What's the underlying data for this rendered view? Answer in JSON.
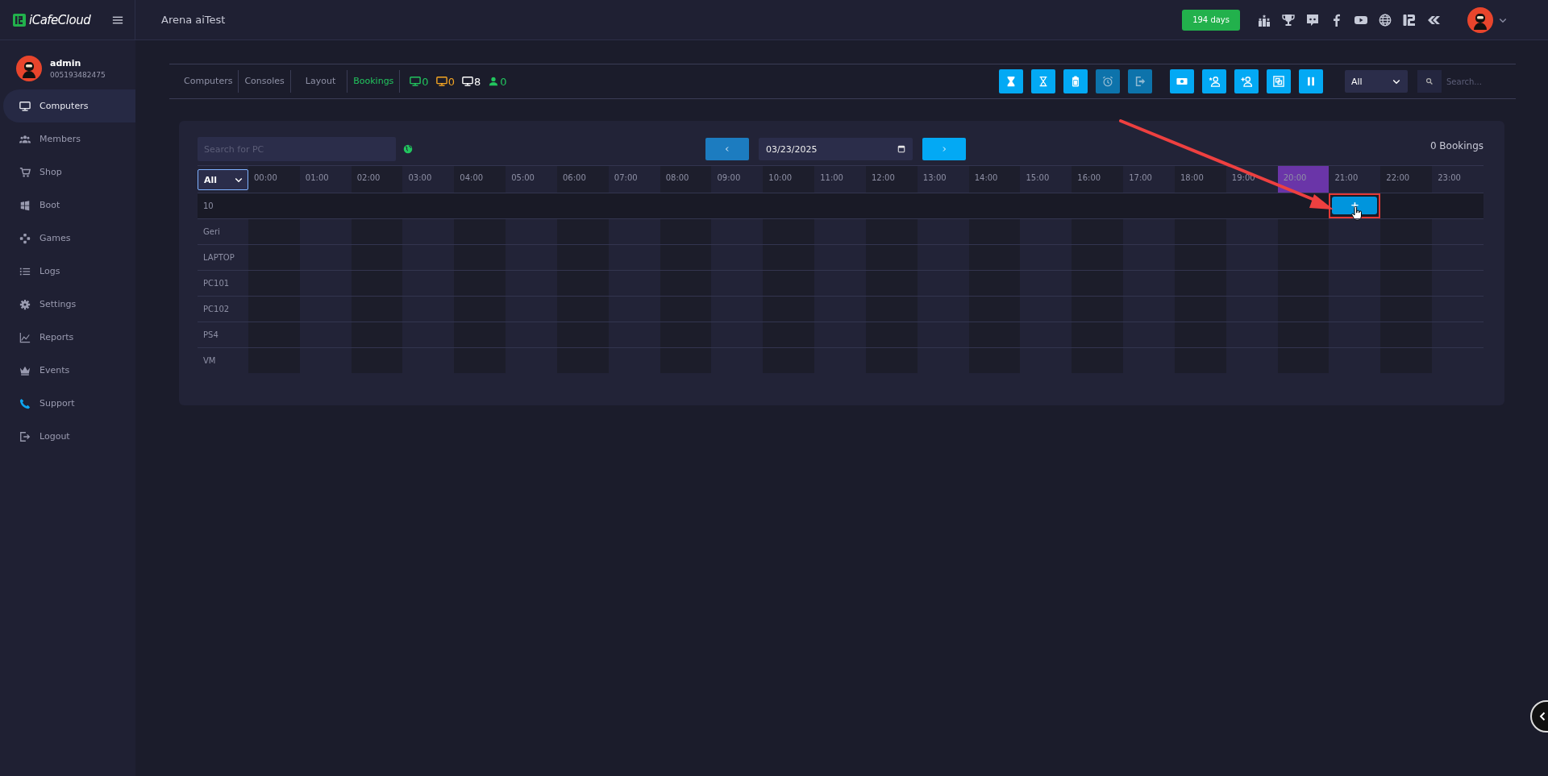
{
  "brand": {
    "name": "iCafeCloud"
  },
  "header": {
    "title": "Arena aiTest",
    "license_badge": "194 days",
    "links": [
      {
        "kind": "ranking"
      },
      {
        "kind": "trophy"
      },
      {
        "kind": "chat"
      },
      {
        "kind": "facebook"
      },
      {
        "kind": "video"
      },
      {
        "kind": "globe"
      },
      {
        "kind": "logo"
      },
      {
        "kind": "chevrons"
      }
    ]
  },
  "user": {
    "name": "admin",
    "id": "005193482475"
  },
  "sidebar": {
    "items": [
      {
        "label": "Computers",
        "kind": "monitor",
        "selected": true
      },
      {
        "label": "Members",
        "kind": "people",
        "selected": false
      },
      {
        "label": "Shop",
        "kind": "cart",
        "selected": false
      },
      {
        "label": "Boot",
        "kind": "windows",
        "selected": false
      },
      {
        "label": "Games",
        "kind": "gamepad",
        "selected": false
      },
      {
        "label": "Logs",
        "kind": "list",
        "selected": false
      },
      {
        "label": "Settings",
        "kind": "gear",
        "selected": false
      },
      {
        "label": "Reports",
        "kind": "chart",
        "selected": false
      },
      {
        "label": "Events",
        "kind": "crown",
        "selected": false
      },
      {
        "label": "Support",
        "kind": "phone",
        "selected": false
      },
      {
        "label": "Logout",
        "kind": "logout",
        "selected": false
      }
    ]
  },
  "tabs": [
    {
      "label": "Computers",
      "selected": false
    },
    {
      "label": "Consoles",
      "selected": false
    },
    {
      "label": "Layout",
      "selected": false
    },
    {
      "label": "Bookings",
      "selected": true
    }
  ],
  "stats": [
    {
      "kind": "monitor",
      "color": "#22c55e",
      "count": "0"
    },
    {
      "kind": "monitor",
      "color": "#f5a623",
      "count": "0"
    },
    {
      "kind": "monitor",
      "color": "#ffffff",
      "count": "8"
    },
    {
      "kind": "person",
      "color": "#22c55e",
      "count": "0"
    }
  ],
  "toolbar": {
    "buttons": [
      {
        "kind": "hourglass-full",
        "disabled": false
      },
      {
        "kind": "hourglass",
        "disabled": false
      },
      {
        "kind": "battery",
        "disabled": false
      },
      {
        "kind": "alarm",
        "disabled": true
      },
      {
        "kind": "exit",
        "disabled": true
      },
      {
        "kind": "money",
        "disabled": false
      },
      {
        "kind": "user-star",
        "disabled": false
      },
      {
        "kind": "user-plus",
        "disabled": false
      },
      {
        "kind": "frame",
        "disabled": false
      },
      {
        "kind": "pause",
        "disabled": false
      }
    ],
    "filter": "All",
    "search": {
      "placeholder": "Search..."
    }
  },
  "bookings": {
    "search": {
      "placeholder": "Search for PC"
    },
    "date": "03/23/2025",
    "count": "0 Bookings",
    "group_filter": "All",
    "add_label": "+",
    "hours": [
      {
        "label": "00:00",
        "current": false,
        "hover_add": false
      },
      {
        "label": "01:00",
        "current": false,
        "hover_add": false
      },
      {
        "label": "02:00",
        "current": false,
        "hover_add": false
      },
      {
        "label": "03:00",
        "current": false,
        "hover_add": false
      },
      {
        "label": "04:00",
        "current": false,
        "hover_add": false
      },
      {
        "label": "05:00",
        "current": false,
        "hover_add": false
      },
      {
        "label": "06:00",
        "current": false,
        "hover_add": false
      },
      {
        "label": "07:00",
        "current": false,
        "hover_add": false
      },
      {
        "label": "08:00",
        "current": false,
        "hover_add": false
      },
      {
        "label": "09:00",
        "current": false,
        "hover_add": false
      },
      {
        "label": "10:00",
        "current": false,
        "hover_add": false
      },
      {
        "label": "11:00",
        "current": false,
        "hover_add": false
      },
      {
        "label": "12:00",
        "current": false,
        "hover_add": false
      },
      {
        "label": "13:00",
        "current": false,
        "hover_add": false
      },
      {
        "label": "14:00",
        "current": false,
        "hover_add": false
      },
      {
        "label": "15:00",
        "current": false,
        "hover_add": false
      },
      {
        "label": "16:00",
        "current": false,
        "hover_add": false
      },
      {
        "label": "17:00",
        "current": false,
        "hover_add": false
      },
      {
        "label": "18:00",
        "current": false,
        "hover_add": false
      },
      {
        "label": "19:00",
        "current": false,
        "hover_add": false
      },
      {
        "label": "20:00",
        "current": true,
        "hover_add": false
      },
      {
        "label": "21:00",
        "current": false,
        "hover_add": true
      },
      {
        "label": "22:00",
        "current": false,
        "hover_add": false
      },
      {
        "label": "23:00",
        "current": false,
        "hover_add": false
      }
    ],
    "rows": [
      {
        "name": "10",
        "hovered": true
      },
      {
        "name": "Geri",
        "hovered": false
      },
      {
        "name": "LAPTOP",
        "hovered": false
      },
      {
        "name": "PC101",
        "hovered": false
      },
      {
        "name": "PC102",
        "hovered": false
      },
      {
        "name": "PS4",
        "hovered": false
      },
      {
        "name": "VM",
        "hovered": false
      }
    ]
  }
}
